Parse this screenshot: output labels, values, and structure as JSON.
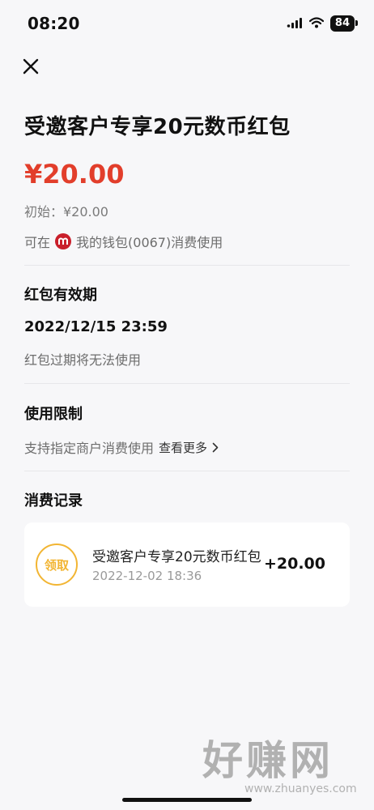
{
  "status": {
    "time": "08:20",
    "battery": "84"
  },
  "header": {
    "title": "受邀客户专享20元数币红包",
    "amount": "¥20.00",
    "initial": "初始：¥20.00",
    "usable_prefix": "可在",
    "usable_suffix": "我的钱包(0067)消费使用"
  },
  "validity": {
    "title": "红包有效期",
    "date": "2022/12/15 23:59",
    "note": "红包过期将无法使用"
  },
  "restriction": {
    "title": "使用限制",
    "text": "支持指定商户消费使用",
    "see_more": "查看更多"
  },
  "records": {
    "title": "消费记录",
    "items": [
      {
        "badge": "领取",
        "title": "受邀客户专享20元数币红包",
        "time": "2022-12-02 18:36",
        "amount": "+20.00"
      }
    ]
  },
  "watermark": {
    "main": "好赚网",
    "url": "www.zhuanyes.com"
  },
  "colors": {
    "accent_red": "#e23e2b",
    "badge_orange": "#f2b533",
    "background": "#f7f7f9"
  }
}
